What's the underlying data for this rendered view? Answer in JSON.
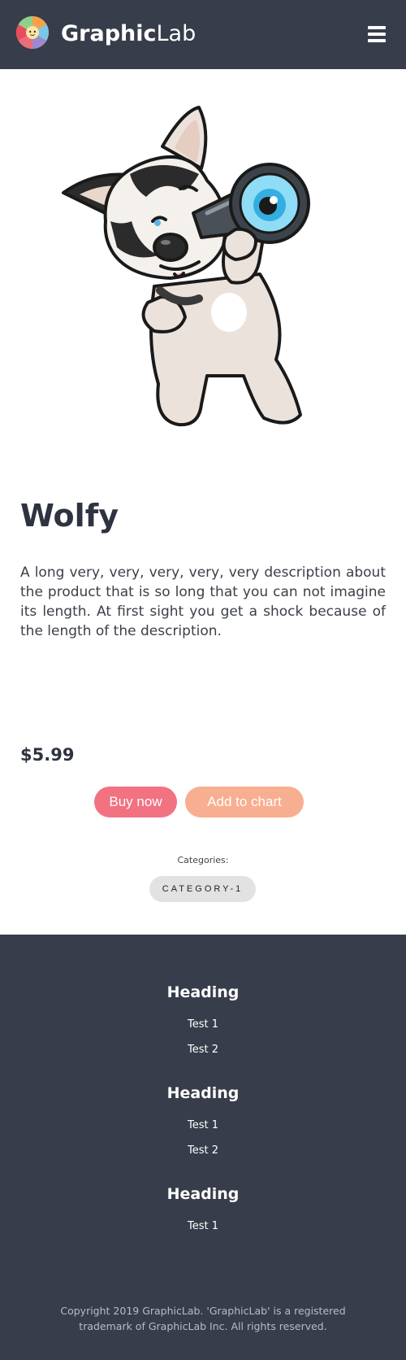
{
  "header": {
    "brand_bold": "Graphic",
    "brand_light": "Lab",
    "menu_icon": "hamburger-menu-icon",
    "logo_icon": "color-wheel-logo-icon"
  },
  "product": {
    "image_icon": "husky-with-spyglass-illustration",
    "title": "Wolfy",
    "description": "A long very, very, very, very, very description about the product that is so long that you can not imagine its length. At first sight you get a shock because of the length of the description.",
    "price": "$5.99",
    "buy_label": "Buy now",
    "cart_label": "Add to chart",
    "categories_label": "Categories:",
    "categories": [
      "CATEGORY-1"
    ]
  },
  "footer": {
    "sections": [
      {
        "heading": "Heading",
        "links": [
          "Test 1",
          "Test 2"
        ]
      },
      {
        "heading": "Heading",
        "links": [
          "Test 1",
          "Test 2"
        ]
      },
      {
        "heading": "Heading",
        "links": [
          "Test 1"
        ]
      }
    ],
    "copyright": "Copyright 2019 GraphicLab. 'GraphicLab' is a registered trademark of GraphicLab Inc. All rights reserved."
  },
  "colors": {
    "header_bg": "#373d4a",
    "buy_button": "#f27282",
    "cart_button": "#f8ae90",
    "chip_bg": "#e2e2e2"
  }
}
